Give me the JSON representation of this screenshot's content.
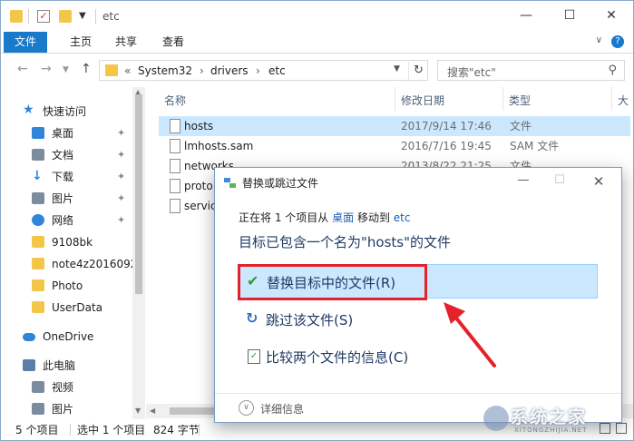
{
  "window": {
    "title": "etc",
    "min_icon": "minimize-icon",
    "max_icon": "maximize-icon",
    "close_icon": "close-icon"
  },
  "ribbon": {
    "tabs": [
      "文件",
      "主页",
      "共享",
      "查看"
    ],
    "accent": "#1979ca"
  },
  "address": {
    "crumbs": [
      "System32",
      "drivers",
      "etc"
    ],
    "prefix": "«",
    "separator": "›"
  },
  "search": {
    "placeholder": "搜索\"etc\""
  },
  "nav": {
    "quick_access": "快速访问",
    "items": [
      {
        "label": "桌面",
        "icon": "desktop-icon",
        "pinned": true
      },
      {
        "label": "文档",
        "icon": "documents-icon",
        "pinned": true
      },
      {
        "label": "下载",
        "icon": "download-icon",
        "pinned": true
      },
      {
        "label": "图片",
        "icon": "pictures-icon",
        "pinned": true
      },
      {
        "label": "网络",
        "icon": "network-icon",
        "pinned": true
      },
      {
        "label": "9108bk",
        "icon": "folder-icon"
      },
      {
        "label": "note4z2016092",
        "icon": "folder-icon"
      },
      {
        "label": "Photo",
        "icon": "folder-icon"
      },
      {
        "label": "UserData",
        "icon": "folder-icon"
      }
    ],
    "onedrive": "OneDrive",
    "this_pc": "此电脑",
    "pc_items": [
      {
        "label": "视频",
        "icon": "videos-icon"
      },
      {
        "label": "图片",
        "icon": "pictures-icon"
      }
    ]
  },
  "files": {
    "columns": [
      "名称",
      "修改日期",
      "类型",
      "大"
    ],
    "rows": [
      {
        "name": "hosts",
        "date": "2017/9/14 17:46",
        "type": "文件",
        "selected": true
      },
      {
        "name": "lmhosts.sam",
        "date": "2016/7/16 19:45",
        "type": "SAM 文件"
      },
      {
        "name": "networks",
        "date": "2013/8/22 21:25",
        "type": "文件"
      },
      {
        "name": "proto",
        "date": "",
        "type": ""
      },
      {
        "name": "servic",
        "date": "",
        "type": ""
      }
    ]
  },
  "status": {
    "count": "5 个项目",
    "selected": "选中 1 个项目",
    "size": "824 字节"
  },
  "dialog": {
    "title": "替换或跳过文件",
    "msg_prefix": "正在将 1 个项目从",
    "from": "桌面",
    "msg_mid": "移动到",
    "to": "etc",
    "heading": "目标已包含一个名为\"hosts\"的文件",
    "options": [
      {
        "label": "替换目标中的文件(R)",
        "icon": "checkmark-icon",
        "highlighted": true
      },
      {
        "label": "跳过该文件(S)",
        "icon": "skip-icon"
      },
      {
        "label": "比较两个文件的信息(C)",
        "icon": "compare-icon"
      }
    ],
    "details": "详细信息"
  },
  "annotation": {
    "color": "#e3222b"
  },
  "watermark": {
    "text": "系统之家",
    "sub": "XITONGZHIJIA.NET"
  }
}
